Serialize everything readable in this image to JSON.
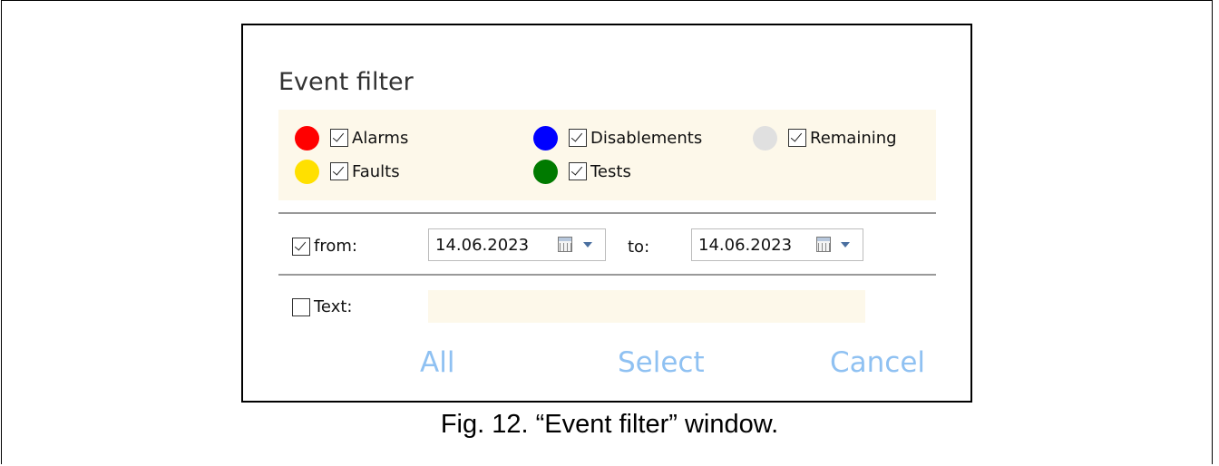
{
  "window": {
    "title": "Event filter",
    "categories": [
      {
        "label": "Alarms",
        "color": "#ff0000",
        "checked": true
      },
      {
        "label": "Disablements",
        "color": "#0000ff",
        "checked": true
      },
      {
        "label": "Remaining",
        "color": "#e0e0e0",
        "checked": true
      },
      {
        "label": "Faults",
        "color": "#ffe000",
        "checked": true
      },
      {
        "label": "Tests",
        "color": "#007a00",
        "checked": true
      }
    ],
    "date_filter": {
      "from_label": "from:",
      "from_checked": true,
      "from_value": "14.06.2023",
      "to_label": "to:",
      "to_value": "14.06.2023"
    },
    "text_filter": {
      "label": "Text:",
      "checked": false,
      "value": ""
    },
    "buttons": {
      "all": "All",
      "select": "Select",
      "cancel": "Cancel"
    }
  },
  "caption": "Fig. 12. “Event filter” window."
}
